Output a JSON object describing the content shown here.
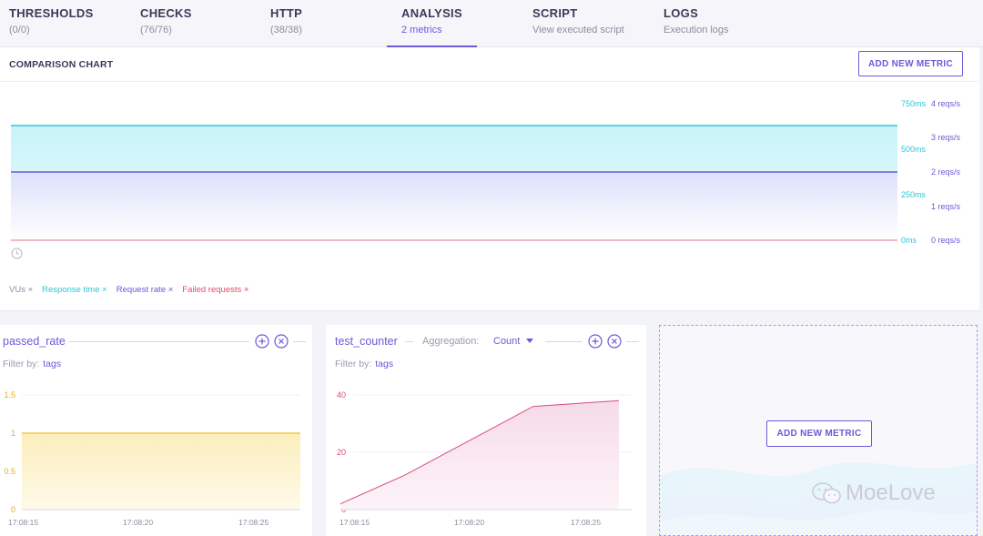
{
  "tabs": [
    {
      "title": "THRESHOLDS",
      "sub": "(0/0)"
    },
    {
      "title": "CHECKS",
      "sub": "(76/76)"
    },
    {
      "title": "HTTP",
      "sub": "(38/38)"
    },
    {
      "title": "ANALYSIS",
      "sub": "2 metrics",
      "active": true
    },
    {
      "title": "SCRIPT",
      "sub": "View executed script"
    },
    {
      "title": "LOGS",
      "sub": "Execution logs"
    }
  ],
  "comparison": {
    "title": "COMPARISON CHART",
    "add_button": "ADD NEW METRIC",
    "left_axis": [
      "750ms",
      "500ms",
      "250ms",
      "0ms"
    ],
    "right_axis": [
      "4 reqs/s",
      "3 reqs/s",
      "2 reqs/s",
      "1 reqs/s",
      "0 reqs/s"
    ],
    "legend": [
      "VUs ×",
      "Response time ×",
      "Request rate ×",
      "Failed requests ×"
    ]
  },
  "colors": {
    "accent": "#6a5ad8",
    "response_time": "#2ec6d8",
    "request_rate": "#6a5ad8",
    "failed": "#e04b6a",
    "vus": "#8c8ca0",
    "passed_rate": "#f0c020",
    "test_counter": "#d84b82"
  },
  "metric_cards": [
    {
      "title": "passed_rate",
      "filter_label": "Filter by:",
      "filter_value": "tags",
      "y_ticks": [
        "1.5",
        "1",
        "0.5",
        "0"
      ],
      "x_ticks": [
        "17:08:15",
        "17:08:20",
        "17:08:25"
      ]
    },
    {
      "title": "test_counter",
      "aggregation_label": "Aggregation:",
      "aggregation_value": "Count",
      "filter_label": "Filter by:",
      "filter_value": "tags",
      "y_ticks": [
        "40",
        "20",
        "0"
      ],
      "x_ticks": [
        "17:08:15",
        "17:08:20",
        "17:08:25"
      ]
    }
  ],
  "add_card": {
    "button": "ADD NEW METRIC",
    "watermark": "MoeLove"
  },
  "chart_data": [
    {
      "type": "area",
      "title": "COMPARISON CHART",
      "series": [
        {
          "name": "Response time",
          "values": [
            630,
            630
          ],
          "unit": "ms"
        },
        {
          "name": "Request rate",
          "values": [
            2,
            2
          ],
          "unit": "reqs/s"
        },
        {
          "name": "Failed requests",
          "values": [
            0,
            0
          ]
        }
      ],
      "ylim_left": [
        0,
        750
      ],
      "ylim_right": [
        0,
        4
      ],
      "legend": "bottom-left"
    },
    {
      "type": "area",
      "title": "passed_rate",
      "x": [
        "17:08:14",
        "17:08:28"
      ],
      "series": [
        {
          "name": "passed_rate",
          "values": [
            1,
            1
          ]
        }
      ],
      "ylim": [
        0,
        1.5
      ],
      "x_ticks": [
        "17:08:15",
        "17:08:20",
        "17:08:25"
      ]
    },
    {
      "type": "area",
      "title": "test_counter",
      "x": [
        "17:08:15",
        "17:08:18",
        "17:08:24",
        "17:08:28"
      ],
      "series": [
        {
          "name": "test_counter",
          "values": [
            2,
            12,
            36,
            38
          ]
        }
      ],
      "ylim": [
        0,
        40
      ],
      "x_ticks": [
        "17:08:15",
        "17:08:20",
        "17:08:25"
      ]
    }
  ]
}
